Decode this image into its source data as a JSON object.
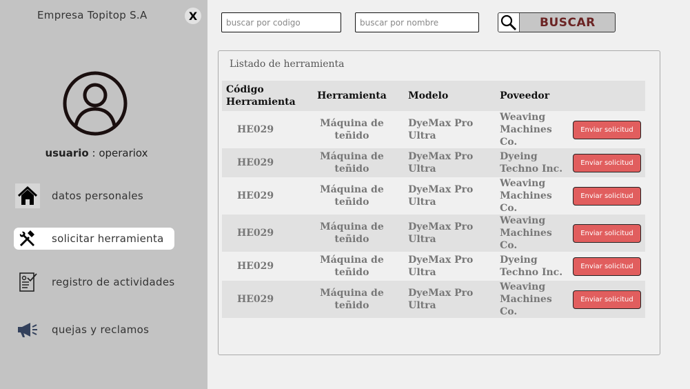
{
  "sidebar": {
    "company": "Empresa Topitop S.A",
    "close_label": "X",
    "user_label": "usuario",
    "user_separator": " : ",
    "user_name": "operariox",
    "nav": [
      {
        "label": "datos personales",
        "icon": "home-icon"
      },
      {
        "label": "solicitar herramienta",
        "icon": "tools-icon",
        "active": true
      },
      {
        "label": "registro de actividades",
        "icon": "clipboard-check-icon"
      },
      {
        "label": "quejas y reclamos",
        "icon": "megaphone-icon"
      }
    ]
  },
  "search": {
    "code_placeholder": "buscar por codigo",
    "name_placeholder": "buscar por nombre",
    "button_label": "BUSCAR"
  },
  "panel": {
    "title": "Listado de herramienta",
    "headers": {
      "code": "Código Herramienta",
      "tool": "Herramienta",
      "model": "Modelo",
      "supplier": "Poveedor"
    },
    "action_label": "Enviar solicitud",
    "rows": [
      {
        "code": "HE029",
        "tool": "Máquina de teñido",
        "model": "DyeMax Pro Ultra",
        "supplier": "Weaving Machines Co."
      },
      {
        "code": "HE029",
        "tool": "Máquina de teñido",
        "model": "DyeMax Pro Ultra",
        "supplier": "Dyeing Techno Inc."
      },
      {
        "code": "HE029",
        "tool": "Máquina de teñido",
        "model": "DyeMax Pro Ultra",
        "supplier": "Weaving Machines Co."
      },
      {
        "code": "HE029",
        "tool": "Máquina de teñido",
        "model": "DyeMax Pro Ultra",
        "supplier": "Weaving Machines Co."
      },
      {
        "code": "HE029",
        "tool": "Máquina de teñido",
        "model": "DyeMax Pro Ultra",
        "supplier": "Dyeing Techno Inc."
      },
      {
        "code": "HE029",
        "tool": "Máquina de teñido",
        "model": "DyeMax Pro Ultra",
        "supplier": "Weaving Machines Co."
      }
    ]
  },
  "colors": {
    "sidebar_bg": "#c3c3c3",
    "request_button": "#e15e5e",
    "search_label": "#6b2424"
  }
}
